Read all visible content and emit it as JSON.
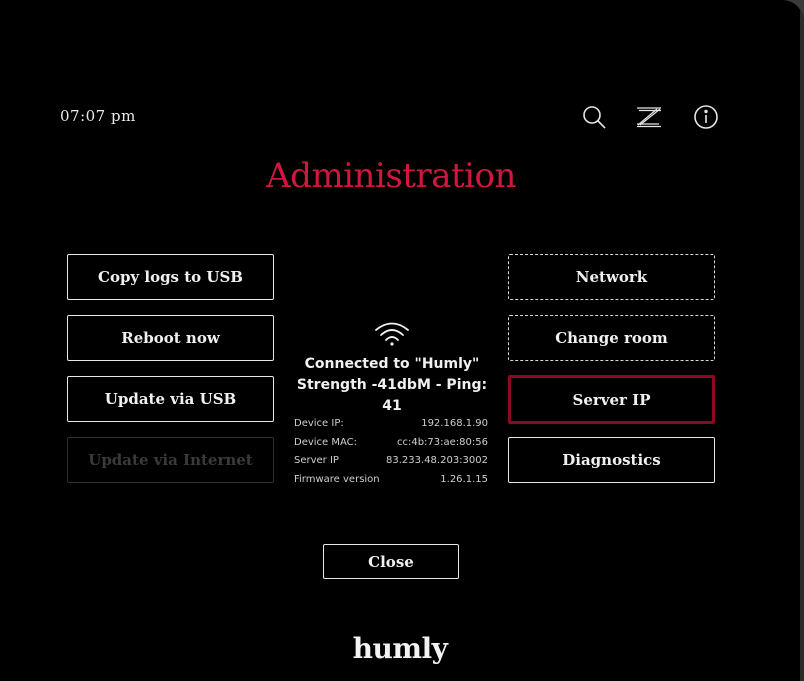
{
  "header": {
    "time": "07:07 pm",
    "icons": [
      "search-icon",
      "z-icon",
      "info-icon"
    ]
  },
  "title": "Administration",
  "left_buttons": {
    "copy_logs": "Copy logs to USB",
    "reboot": "Reboot now",
    "update_usb": "Update via USB",
    "update_internet": "Update via Internet"
  },
  "right_buttons": {
    "network": "Network",
    "change_room": "Change room",
    "server_ip": "Server IP",
    "diagnostics": "Diagnostics"
  },
  "status": {
    "connected": "Connected to \"Humly\"",
    "strength": "Strength -41dbM - Ping: 41",
    "details": [
      {
        "label": "Device IP:",
        "value": "192.168.1.90"
      },
      {
        "label": "Device MAC:",
        "value": "cc:4b:73:ae:80:56"
      },
      {
        "label": "Server IP",
        "value": "83.233.48.203:3002"
      },
      {
        "label": "Firmware version",
        "value": "1.26.1.15"
      }
    ]
  },
  "close_label": "Close",
  "logo_text": "humly",
  "colors": {
    "accent": "#d0183e",
    "selected_border": "#8b0a22",
    "background": "#000000"
  }
}
